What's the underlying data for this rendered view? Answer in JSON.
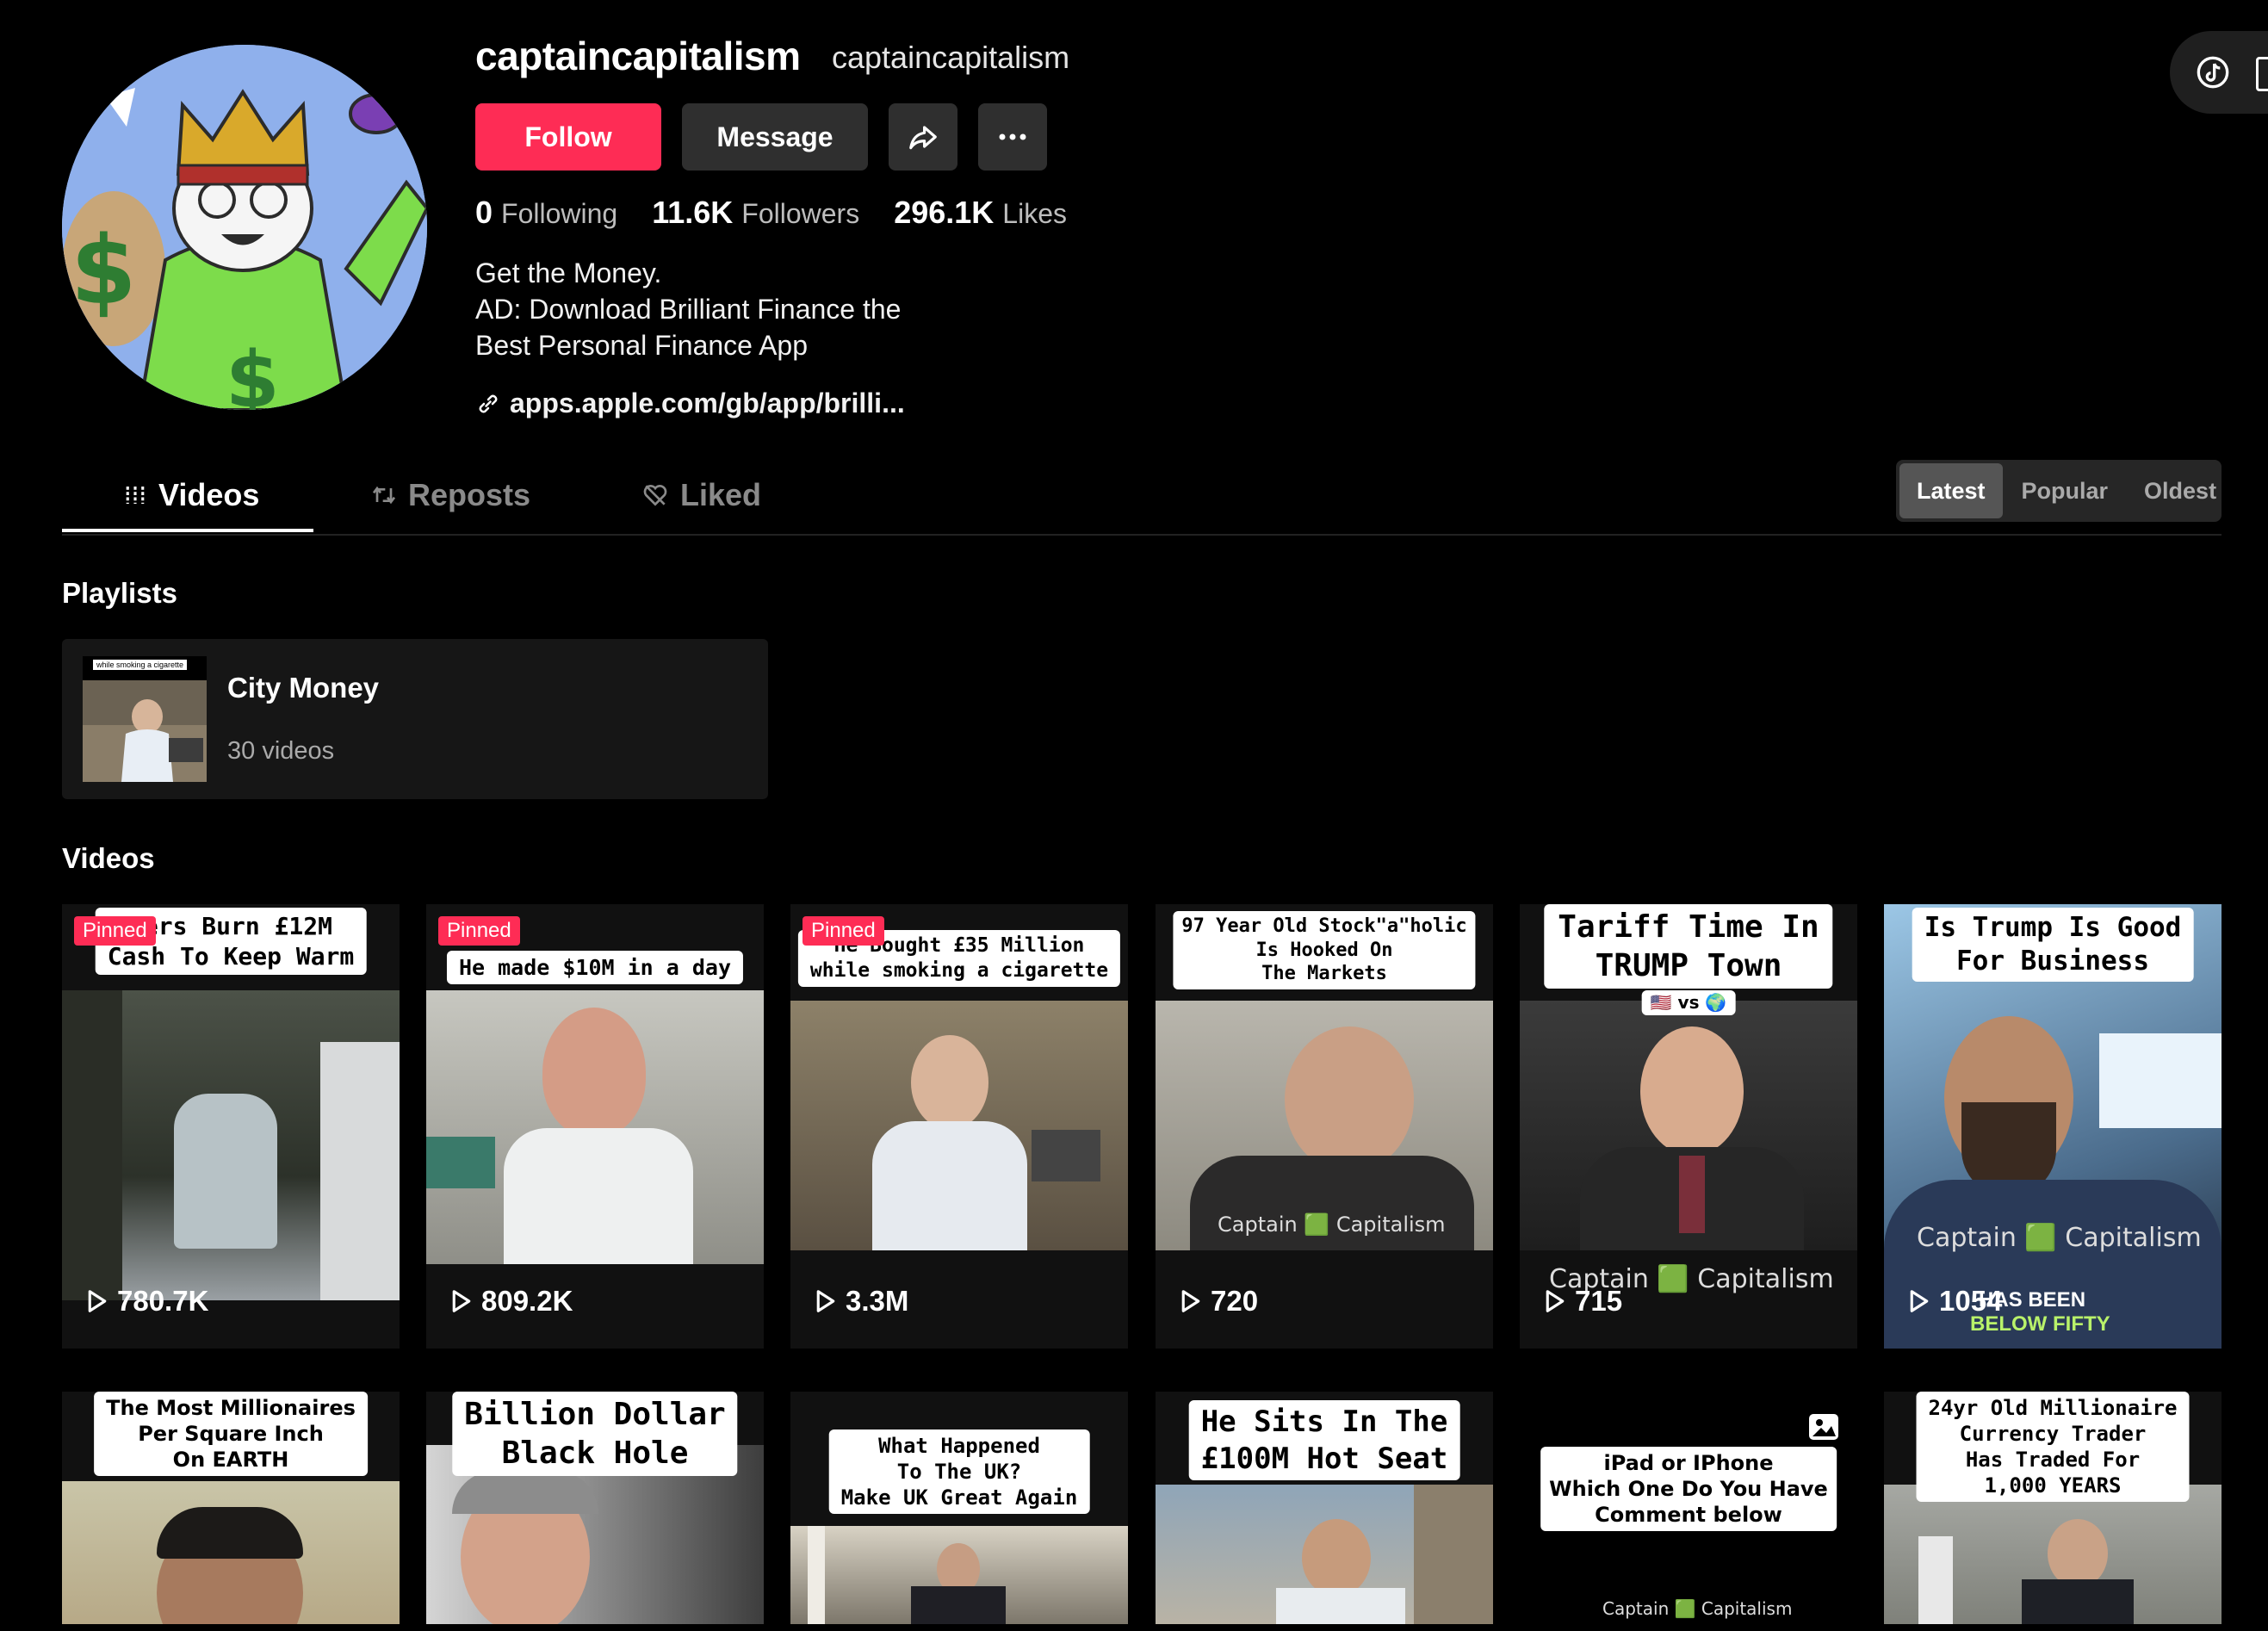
{
  "profile": {
    "username": "captaincapitalism",
    "nickname": "captaincapitalism",
    "follow_label": "Follow",
    "message_label": "Message",
    "following_count": "0",
    "following_label": "Following",
    "followers_count": "11.6K",
    "followers_label": "Followers",
    "likes_count": "296.1K",
    "likes_label": "Likes",
    "bio": [
      "Get the Money.",
      "AD: Download Brilliant Finance the",
      "Best Personal Finance App"
    ],
    "link": "apps.apple.com/gb/app/brilli..."
  },
  "tabs": [
    {
      "label": "Videos",
      "active": true
    },
    {
      "label": "Reposts",
      "active": false
    },
    {
      "label": "Liked",
      "active": false
    }
  ],
  "sort": {
    "options": [
      "Latest",
      "Popular",
      "Oldest"
    ],
    "selected": "Latest"
  },
  "playlists": {
    "title": "Playlists",
    "items": [
      {
        "name": "City Money",
        "count": "30 videos",
        "thumb_caption": "while smoking a cigarette"
      }
    ]
  },
  "videos": {
    "title": "Videos",
    "pinned_label": "Pinned",
    "row1": [
      {
        "caption": [
          "kers Burn £12M",
          "Cash To Keep Warm"
        ],
        "views": "780.7K",
        "pinned": true
      },
      {
        "caption": [
          "He made $10M in a day"
        ],
        "views": "809.2K",
        "pinned": true
      },
      {
        "caption": [
          "He Bought £35 Million",
          "while smoking a cigarette"
        ],
        "views": "3.3M",
        "pinned": true
      },
      {
        "caption": [
          "97 Year Old Stock\"a\"holic",
          "Is Hooked On",
          "The Markets"
        ],
        "views": "720",
        "pinned": false,
        "watermark": "Captain 🟩 Capitalism"
      },
      {
        "caption": [
          "Tariff Time In",
          "TRUMP Town"
        ],
        "sub": "🇺🇸 vs 🌍",
        "views": "715",
        "pinned": false,
        "watermark": "Captain 🟩 Capitalism"
      },
      {
        "caption": [
          "Is Trump Is Good",
          "For Business"
        ],
        "views": "1054",
        "pinned": false,
        "watermark": "Captain 🟩 Capitalism",
        "overlay": [
          "HAS BEEN",
          "BELOW FIFTY"
        ]
      }
    ],
    "row2": [
      {
        "caption": [
          "The Most Millionaires",
          "Per Square Inch",
          "On EARTH"
        ]
      },
      {
        "caption": [
          "Billion Dollar",
          "Black Hole"
        ]
      },
      {
        "caption": [
          "What Happened",
          "To The UK?",
          "Make UK Great Again"
        ]
      },
      {
        "caption": [
          "He Sits In The",
          "£100M Hot Seat"
        ]
      },
      {
        "caption": [
          "iPad or IPhone",
          "Which One Do You Have",
          "Comment below"
        ],
        "watermark": "Captain 🟩 Capitalism"
      },
      {
        "caption": [
          "24yr Old Millionaire",
          "Currency Trader",
          "Has Traded For",
          "1,000 YEARS"
        ]
      }
    ]
  },
  "colors": {
    "accent": "#fe2c55",
    "background": "#000000"
  }
}
